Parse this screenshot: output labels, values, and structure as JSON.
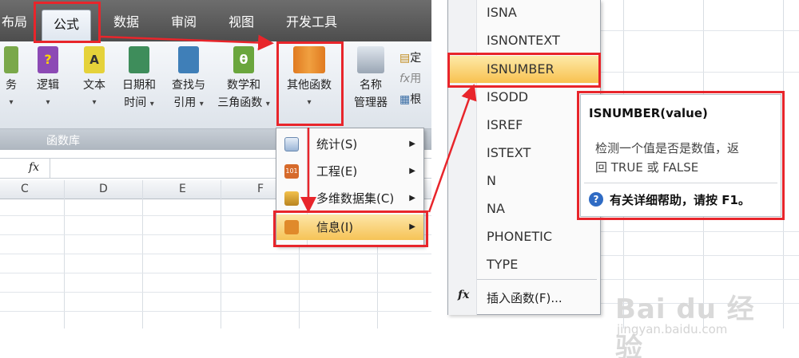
{
  "ribbon_tabs": [
    {
      "label": "布局"
    },
    {
      "label": "公式"
    },
    {
      "label": "数据"
    },
    {
      "label": "审阅"
    },
    {
      "label": "视图"
    },
    {
      "label": "开发工具"
    }
  ],
  "ribbon": {
    "buttons": [
      {
        "line1": "务",
        "line2": ""
      },
      {
        "line1": "逻辑",
        "line2": ""
      },
      {
        "line1": "文本",
        "line2": ""
      },
      {
        "line1": "日期和",
        "line2": "时间"
      },
      {
        "line1": "查找与",
        "line2": "引用"
      },
      {
        "line1": "数学和",
        "line2": "三角函数"
      },
      {
        "line1": "其他函数",
        "line2": ""
      },
      {
        "line1": "名称",
        "line2": "管理器"
      }
    ],
    "side_items": [
      "定",
      "用",
      "根"
    ],
    "group_label": "函数库"
  },
  "formula_bar": {
    "fx": "fx"
  },
  "columns": [
    "C",
    "D",
    "E",
    "F"
  ],
  "context_menu": {
    "items": [
      {
        "label": "统计(S)"
      },
      {
        "label": "工程(E)"
      },
      {
        "label": "多维数据集(C)"
      },
      {
        "label": "信息(I)"
      }
    ]
  },
  "function_list": {
    "items": [
      "ISNA",
      "ISNONTEXT",
      "ISNUMBER",
      "ISODD",
      "ISREF",
      "ISTEXT",
      "N",
      "NA",
      "PHONETIC",
      "TYPE"
    ],
    "selected": "ISNUMBER",
    "insert_label": "插入函数(F)..."
  },
  "tooltip": {
    "title": "ISNUMBER(value)",
    "body_line1": "检测一个值是否是数值，返",
    "body_line2": "回 TRUE 或 FALSE",
    "help": "有关详细帮助，请按 F1。"
  },
  "watermark": {
    "main": "Bai du 经验",
    "sub": "jingyan.baidu.com"
  },
  "colors": {
    "highlight_red": "#e8252b",
    "selected_row": "#f8c150",
    "ribbon_dark": "#4b4b4b"
  }
}
